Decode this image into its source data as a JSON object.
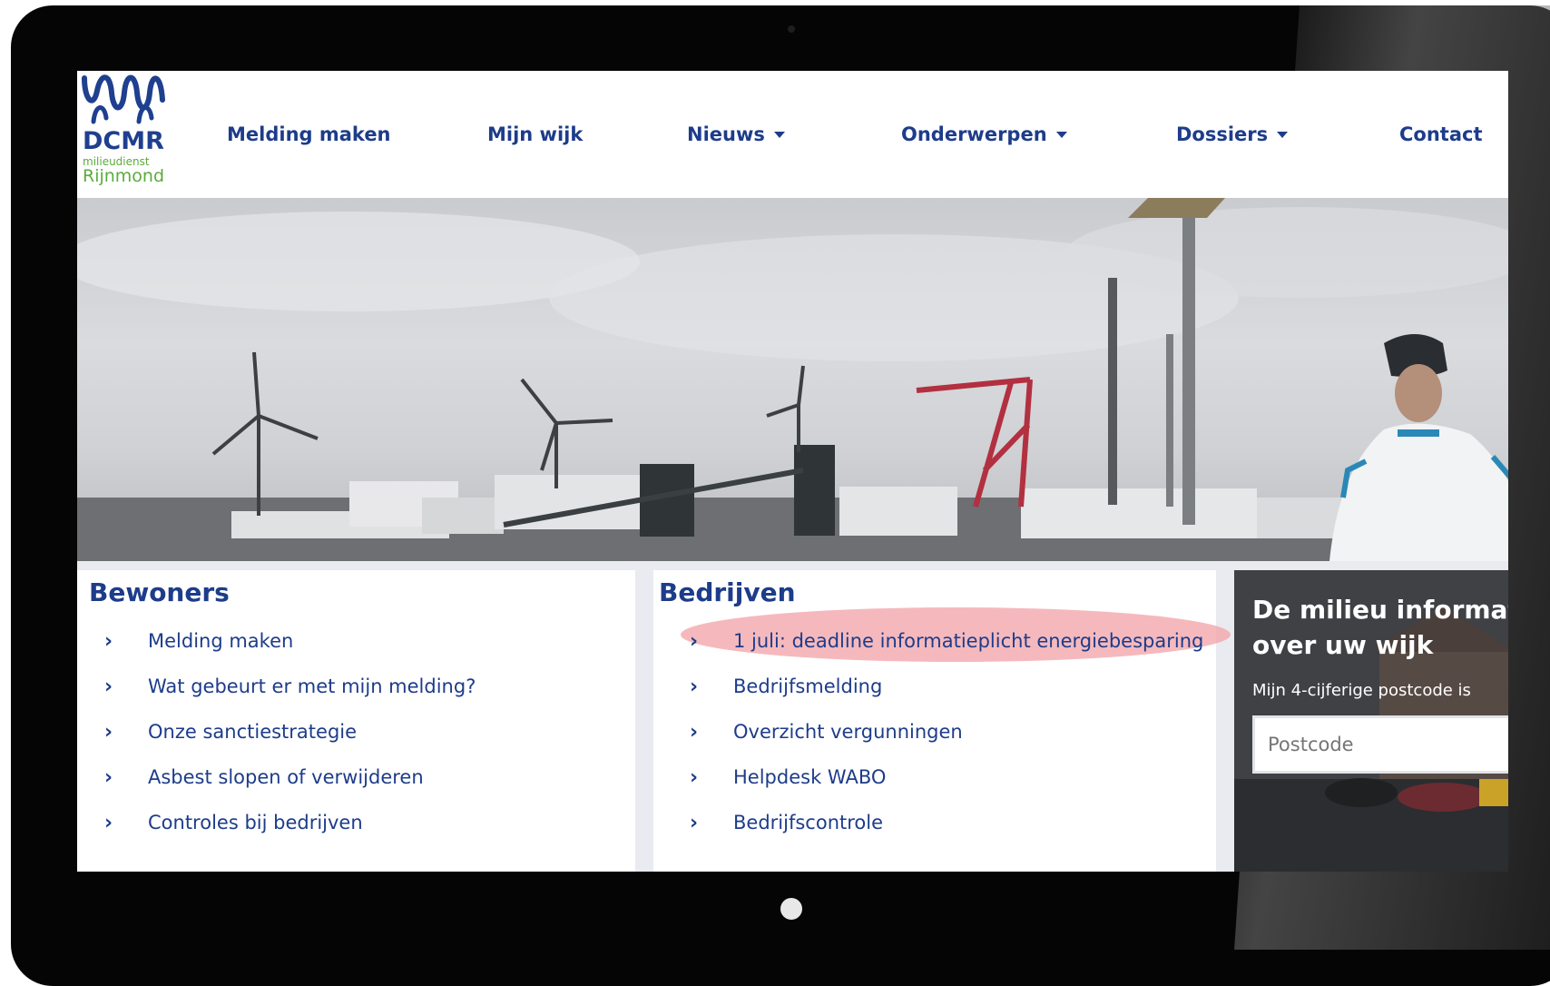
{
  "logo": {
    "name": "DCMR",
    "sub1": "milieudienst",
    "sub2": "Rijnmond"
  },
  "nav": {
    "melding_maken": "Melding maken",
    "mijn_wijk": "Mijn wijk",
    "nieuws": "Nieuws",
    "onderwerpen": "Onderwerpen",
    "dossiers": "Dossiers",
    "contact": "Contact"
  },
  "bewoners": {
    "title": "Bewoners",
    "items": [
      "Melding maken",
      "Wat gebeurt er met mijn melding?",
      "Onze sanctiestrategie",
      "Asbest slopen of verwijderen",
      "Controles bij bedrijven"
    ]
  },
  "bedrijven": {
    "title": "Bedrijven",
    "items": [
      "1 juli: deadline informatieplicht energiebesparing",
      "Bedrijfsmelding",
      "Overzicht vergunningen",
      "Helpdesk WABO",
      "Bedrijfscontrole"
    ]
  },
  "wijk": {
    "title_line1": "De milieu informatie",
    "title_line2": "over uw wijk",
    "label": "Mijn 4-cijferige postcode is",
    "placeholder": "Postcode"
  },
  "colors": {
    "brand_blue": "#1d3c8a",
    "brand_green": "#5aac3c",
    "highlight": "#f2a2a7"
  }
}
